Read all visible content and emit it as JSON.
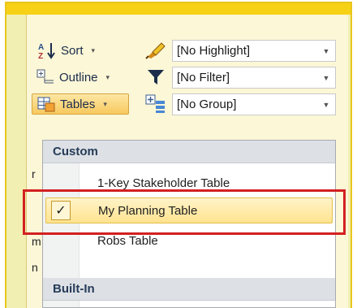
{
  "ribbon": {
    "sort_label": "Sort",
    "outline_label": "Outline",
    "tables_label": "Tables",
    "highlight_value": "[No Highlight]",
    "filter_value": "[No Filter]",
    "group_value": "[No Group]",
    "sort_arrow": "▾",
    "outline_arrow": "▾",
    "tables_arrow": "▾"
  },
  "menu": {
    "custom_header": "Custom",
    "items": [
      {
        "label": "1-Key Stakeholder Table",
        "checked": false
      },
      {
        "label": "My Planning Table",
        "checked": true
      },
      {
        "label": "Robs Table",
        "checked": false
      }
    ],
    "builtin_header": "Built-In",
    "check_mark": "✓"
  },
  "colors": {
    "highlight_border": "#d32020",
    "selected_fill": "#ffe38f",
    "frame_yellow": "#f6d116"
  }
}
